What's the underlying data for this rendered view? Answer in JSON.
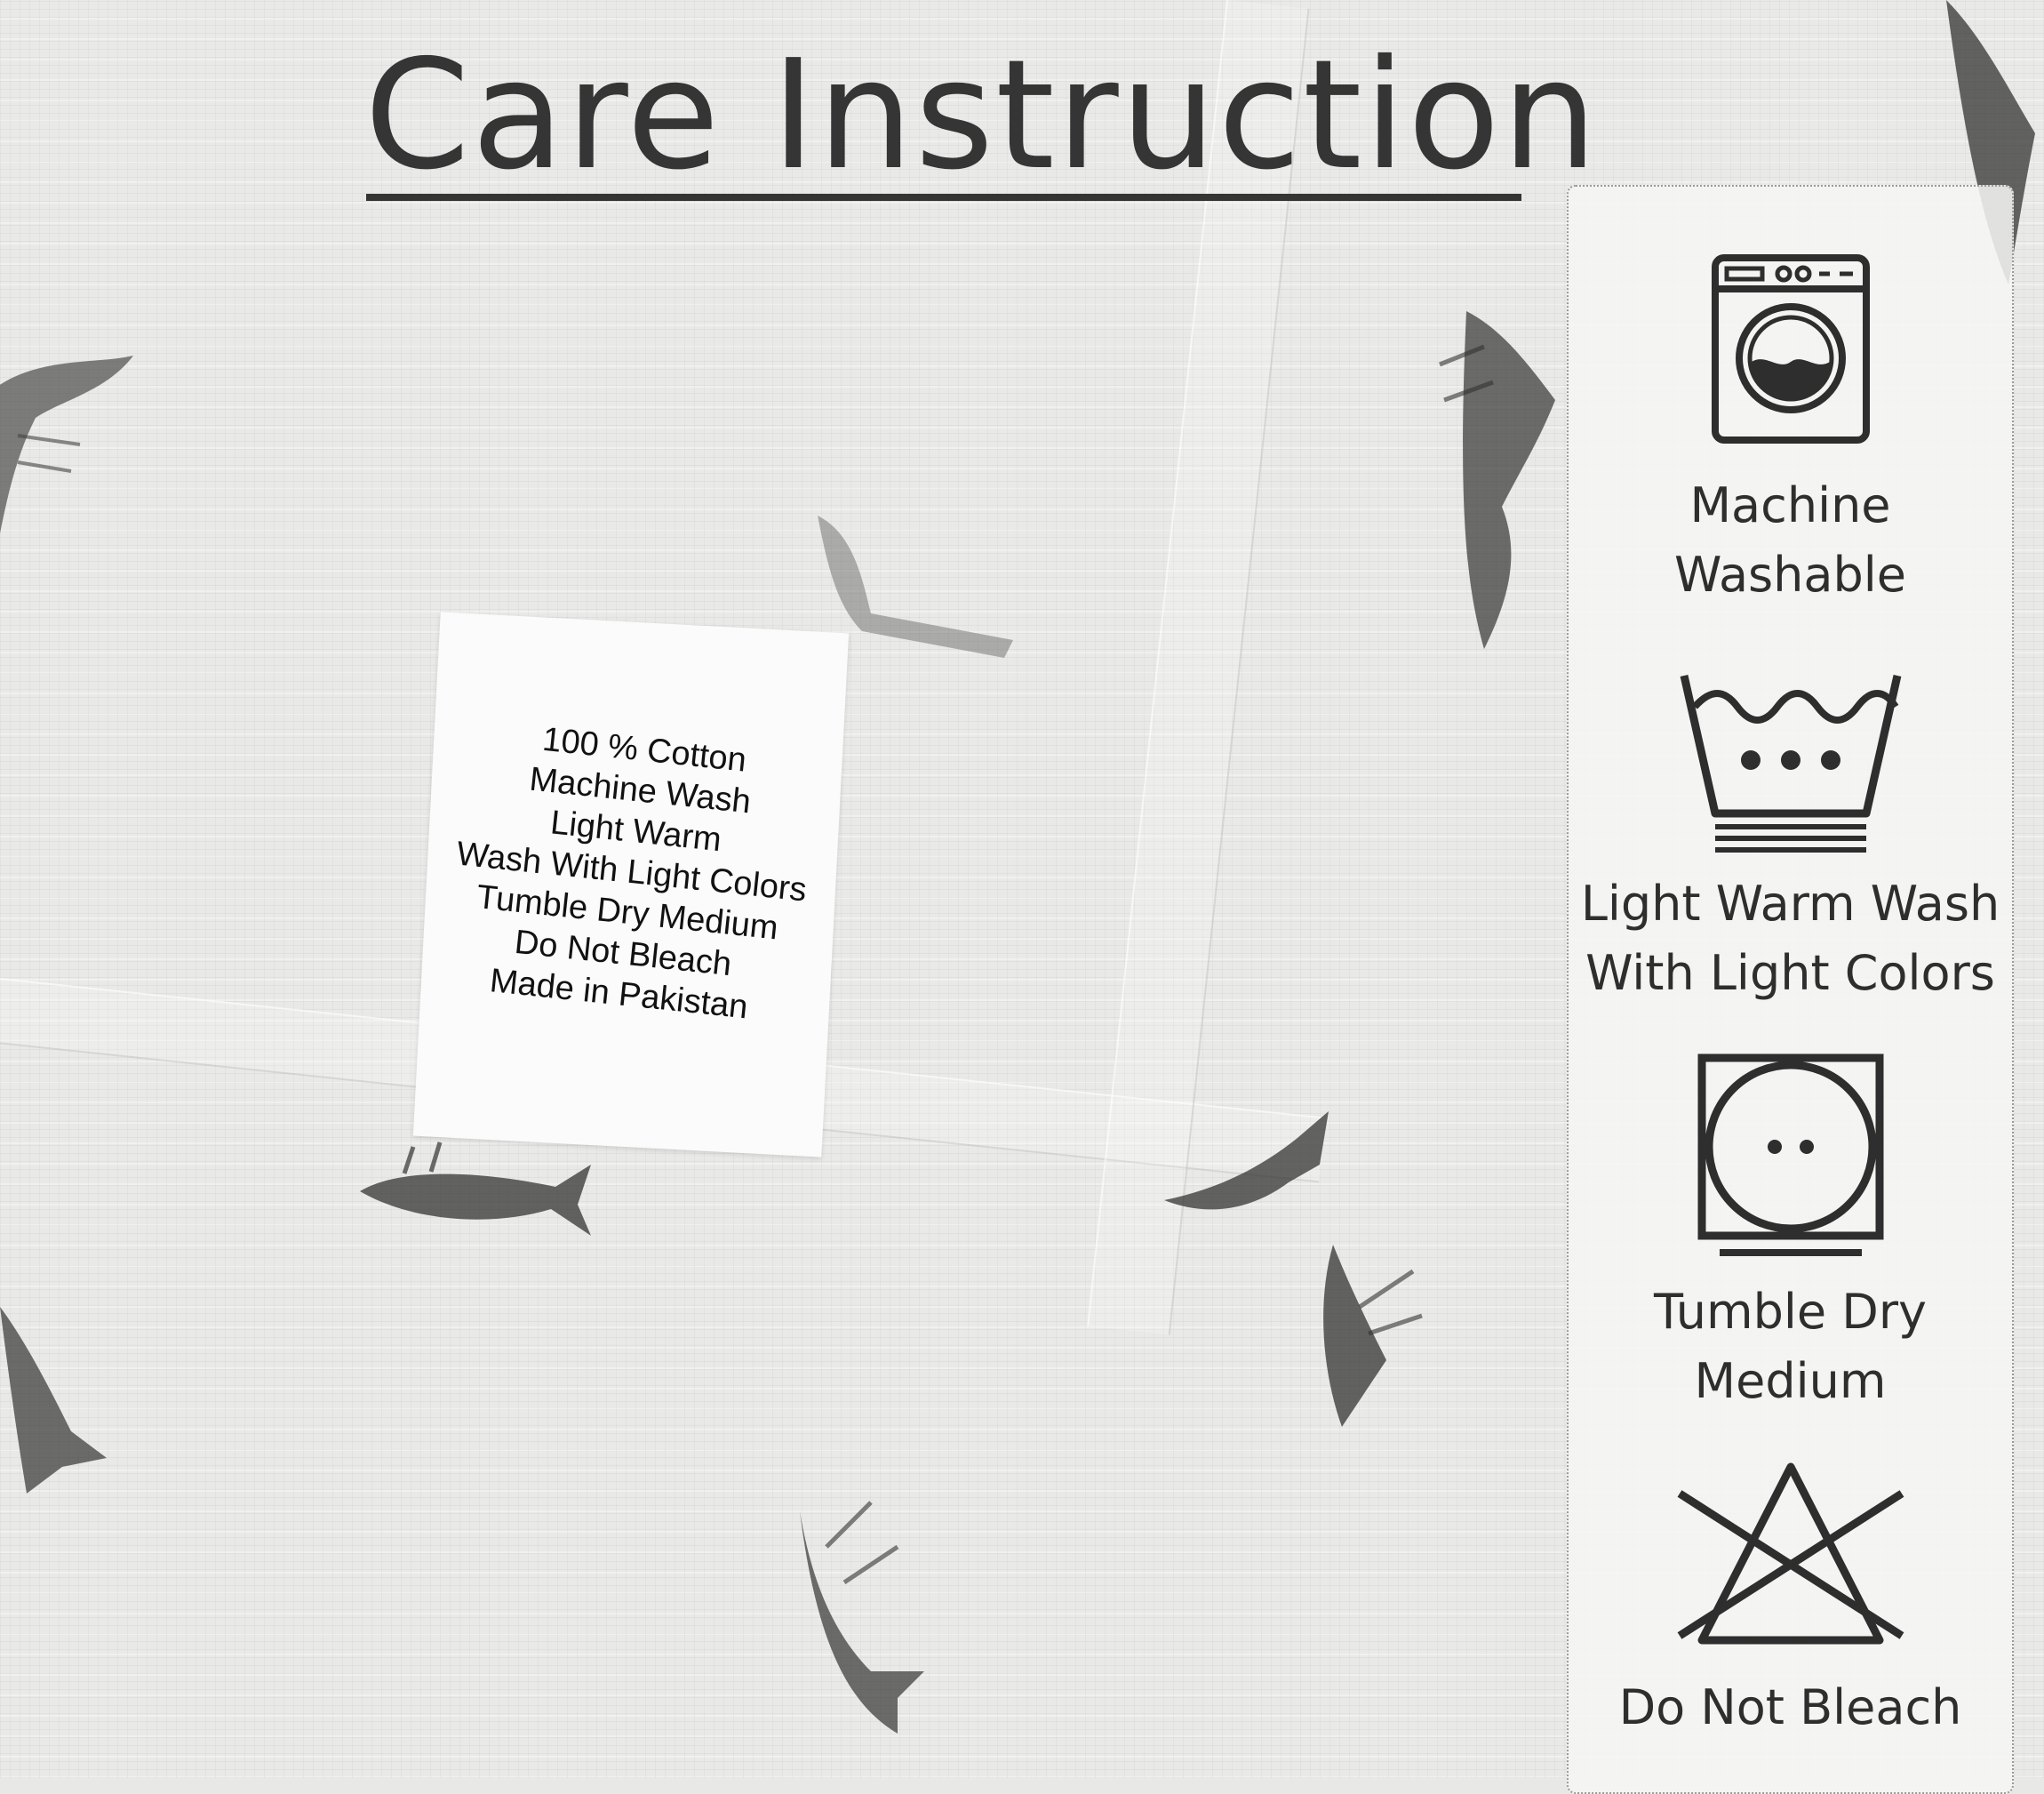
{
  "header": {
    "title": "Care Instruction"
  },
  "sewn_label": {
    "lines": [
      "100 % Cotton",
      "Machine Wash",
      "Light Warm",
      "Wash With Light Colors",
      "Tumble Dry Medium",
      "Do Not Bleach",
      "Made in Pakistan"
    ]
  },
  "care_panel": {
    "items": [
      {
        "icon": "washing-machine-icon",
        "line1": "Machine",
        "line2": "Washable"
      },
      {
        "icon": "wash-tub-three-dots-icon",
        "line1": "Light Warm Wash",
        "line2": "With Light Colors"
      },
      {
        "icon": "tumble-dry-medium-icon",
        "line1": "Tumble Dry",
        "line2": "Medium"
      },
      {
        "icon": "do-not-bleach-icon",
        "line1": "Do Not Bleach",
        "line2": ""
      }
    ]
  },
  "colors": {
    "ink": "#353535",
    "fabric": "#e9e9e7",
    "panel": "#f6f6f4"
  }
}
